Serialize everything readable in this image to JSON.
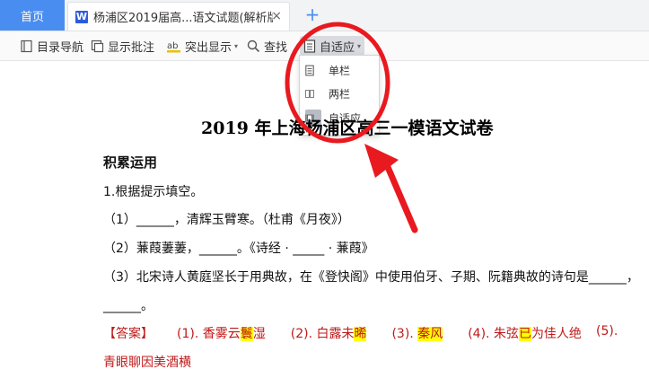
{
  "tabs": {
    "home": "首页",
    "doc_title": "杨浦区2019届高...语文试题(解析版)",
    "doc_icon": "W",
    "close": "×",
    "add": "+"
  },
  "toolbar": {
    "toc": "目录导航",
    "comments": "显示批注",
    "highlight": "突出显示",
    "find": "查找",
    "adapt": "自适应"
  },
  "dropdown": {
    "items": [
      "单栏",
      "两栏",
      "自适应"
    ],
    "selected": "自适应"
  },
  "document": {
    "title": "2019 年上海杨浦区高三一模语文试卷",
    "section": "积累运用",
    "q1": "1.根据提示填空。",
    "q1_1": "（1）______，清辉玉臂寒。（杜甫《月夜》）",
    "q1_2": "（2）蒹葭萋萋，______。《诗经 · _____ · 蒹葭》",
    "q1_3a": "（3）北宋诗人黄庭坚长于用典故，在《登快阁》中使用伯牙、子期、阮籍典故的诗句是______，",
    "q1_3b": "______。",
    "answer_label": "【答案】",
    "a1_pre": "(1). 香雾云",
    "a1_hl": "鬟",
    "a1_post": "湿",
    "a2_pre": "(2). 白露未",
    "a2_hl": "晞",
    "a3_pre": "(3). ",
    "a3_hl": "秦风",
    "a4_pre": "(4). 朱弦",
    "a4_hl": "已",
    "a4_post": "为佳人绝",
    "a5": "(5).",
    "a5_cont": "青眼聊因美酒横"
  },
  "colors": {
    "accent": "#4a8df0",
    "answer": "#c01818",
    "highlight": "#ffff00",
    "annotation": "#e8191f"
  }
}
